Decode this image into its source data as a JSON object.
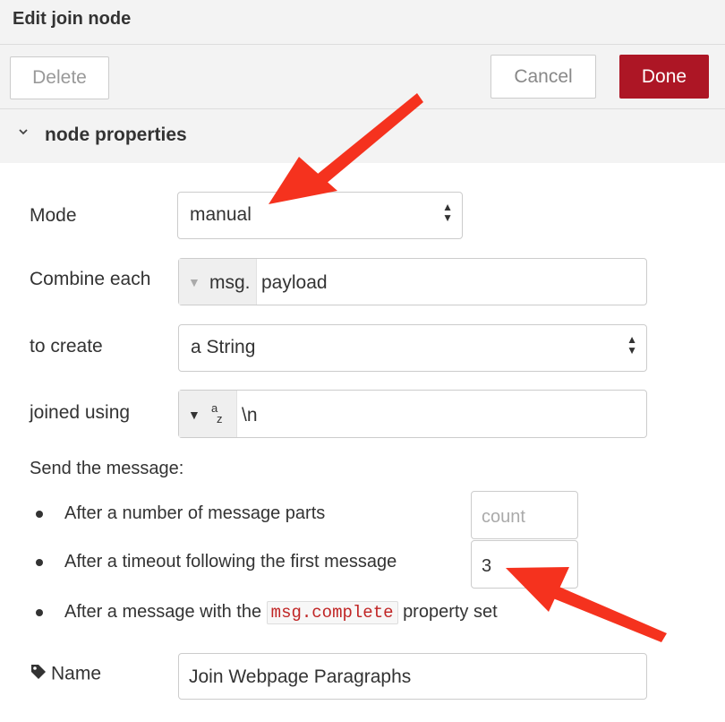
{
  "header": {
    "title": "Edit join node"
  },
  "toolbar": {
    "delete_label": "Delete",
    "cancel_label": "Cancel",
    "done_label": "Done"
  },
  "section": {
    "title": "node properties",
    "chevron_icon": "chevron-down-icon"
  },
  "form": {
    "mode": {
      "label": "Mode",
      "value": "manual"
    },
    "combine": {
      "label": "Combine each",
      "prefix": "msg.",
      "value": "payload"
    },
    "create": {
      "label": "to create",
      "value": "a String"
    },
    "joined": {
      "label": "joined using",
      "type_icon": "az",
      "value": "\\n"
    },
    "send": {
      "label": "Send the message:",
      "parts_text": "After a number of message parts",
      "parts_placeholder": "count",
      "timeout_text": "After a timeout following the first message",
      "timeout_value": "3",
      "complete_pre": "After a message with the",
      "complete_code": "msg.complete",
      "complete_post": "property set"
    },
    "name": {
      "label": "Name",
      "value": "Join Webpage Paragraphs",
      "icon": "tag-icon"
    }
  },
  "colors": {
    "done_button": "#ad1625",
    "annotation_arrow": "#f5321e",
    "code_text": "#c02525"
  }
}
